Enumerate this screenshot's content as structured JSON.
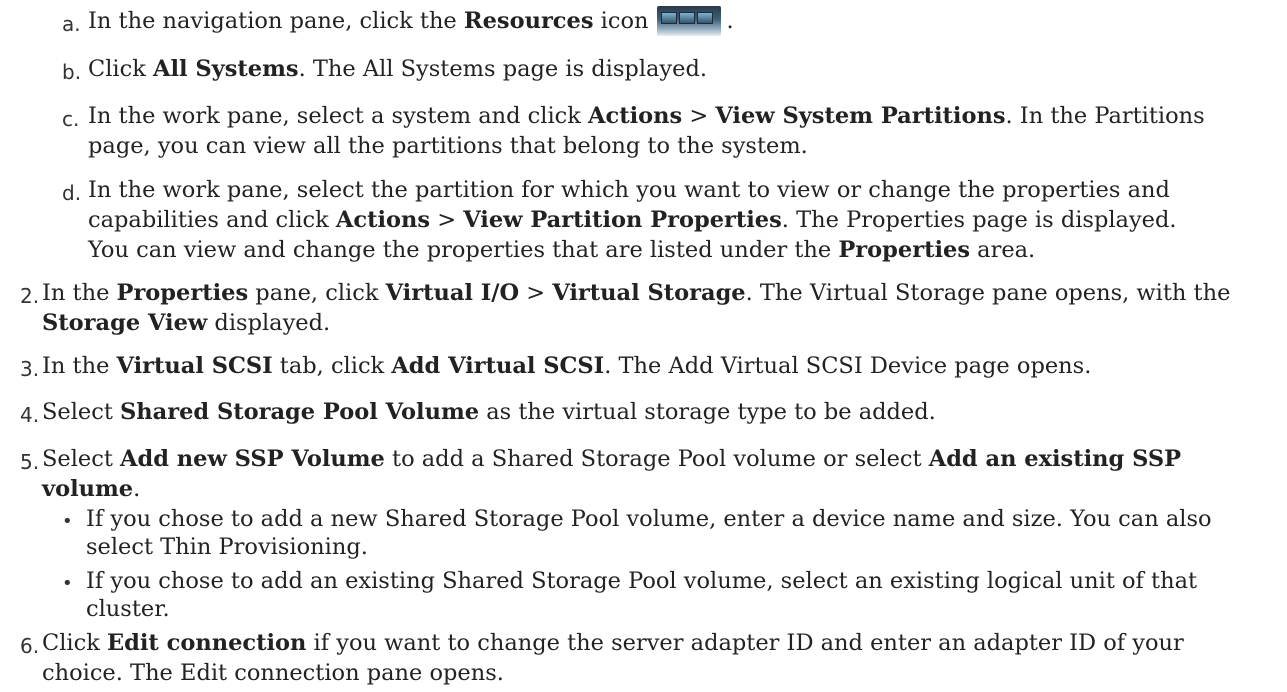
{
  "steps": {
    "a": {
      "marker": "a.",
      "pre": "In the navigation pane, click the ",
      "bold": "Resources",
      "post": " icon",
      "after_icon": "."
    },
    "b": {
      "marker": "b.",
      "bold": "All Systems",
      "post": ". The All Systems page is displayed."
    },
    "c": {
      "marker": "c.",
      "line1_pre": "In the work pane, select a system and click ",
      "b1": "Actions",
      "gt": " > ",
      "b2": "View System Partitions",
      "line1_post": ". In the Partitions",
      "line2": "page, you can view all the partitions that belong to the system."
    },
    "d": {
      "marker": "d.",
      "line1": "In the work pane, select the partition for which you want to view or change the properties and",
      "line2_pre": "capabilities and click ",
      "b1": "Actions",
      "gt": " > ",
      "b2": "View Partition Properties",
      "line2_post": ". The Properties page is displayed.",
      "line3_pre": "You can view and change the properties that are listed under the ",
      "b3": "Properties",
      "line3_post": " area."
    },
    "s2": {
      "marker": "2.",
      "pre": "In the ",
      "b1": "Properties",
      "mid1": " pane, click ",
      "b2": "Virtual I/O",
      "gt": " > ",
      "b3": "Virtual Storage",
      "post": ". The Virtual Storage pane opens, with the",
      "line2_b": "Storage View",
      "line2_post": " displayed."
    },
    "s3": {
      "marker": "3.",
      "pre": "In the ",
      "b1": "Virtual SCSI",
      "mid": " tab, click ",
      "b2": "Add Virtual SCSI",
      "post": ". The Add Virtual SCSI Device page opens."
    },
    "s4": {
      "marker": "4.",
      "pre": "Select ",
      "b1": "Shared Storage Pool Volume",
      "post": " as the virtual storage type to be added."
    },
    "s5": {
      "marker": "5.",
      "pre": "Select ",
      "b1": "Add new SSP Volume",
      "mid": " to add a Shared Storage Pool volume or select ",
      "b2": "Add an existing SSP",
      "line2_b": "volume",
      "line2_post": "."
    },
    "bullet1": {
      "marker": "•",
      "line1": "If you chose to add a new Shared Storage Pool volume, enter a device name and size. You can also",
      "line2": "select Thin Provisioning."
    },
    "bullet2": {
      "marker": "•",
      "line1": "If you chose to add an existing Shared Storage Pool volume, select an existing logical unit of that",
      "line2": "cluster."
    },
    "s6": {
      "marker": "6.",
      "pre": "Click ",
      "b1": "Edit connection",
      "post": " if you want to change the server adapter ID and enter an adapter ID of your",
      "line2": "choice. The Edit connection pane opens."
    }
  },
  "icons": {
    "resources": "server-rack-icon"
  }
}
